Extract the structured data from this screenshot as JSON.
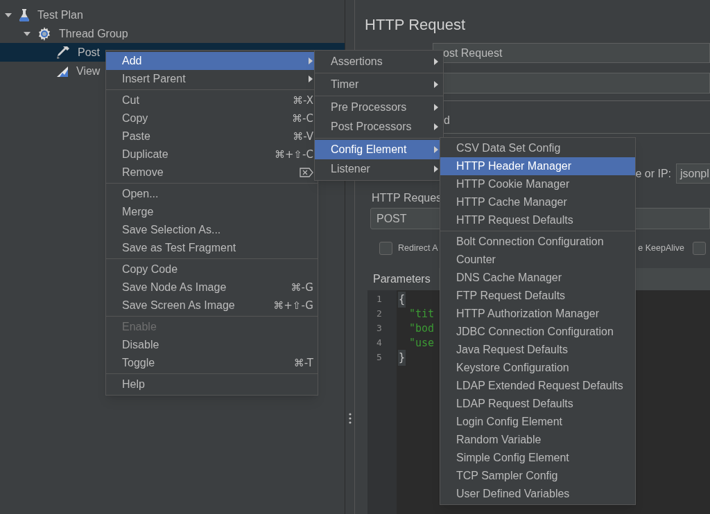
{
  "tree": [
    {
      "label": "Test Plan",
      "kind": "test_plan",
      "expanded": true,
      "selected": false,
      "children": [
        {
          "label": "Thread Group",
          "kind": "thread_group",
          "expanded": true,
          "selected": false,
          "children": [
            {
              "label": "Post",
              "kind": "sampler",
              "selected": false,
              "selected_row": true
            },
            {
              "label": "View",
              "kind": "listener",
              "selected": false,
              "selected_row": false
            }
          ]
        }
      ]
    }
  ],
  "form": {
    "title": "HTTP Request",
    "name_value": "ost Request",
    "tab_fragment": "d",
    "server_label": "e or IP:",
    "server_value": "jsonpl",
    "request_group_label": "HTTP Reques",
    "method": "POST",
    "checkboxes": [
      {
        "label": "Redirect A",
        "checked": false
      },
      {
        "label": "e KeepAlive",
        "checked": false
      }
    ],
    "tabs": [
      {
        "label": "Parameters",
        "selected": true
      }
    ],
    "code_lines": [
      {
        "number": "1",
        "text": "{",
        "kind": "brace"
      },
      {
        "number": "2",
        "text": "\"tit",
        "kind": "string"
      },
      {
        "number": "3",
        "text": "\"bod",
        "kind": "string"
      },
      {
        "number": "4",
        "text": "\"use",
        "kind": "string"
      },
      {
        "number": "5",
        "text": "}",
        "kind": "brace"
      }
    ]
  },
  "context_menu": {
    "groups": [
      [
        {
          "label": "Add",
          "kind": "submenu",
          "selected": true,
          "disabled": false
        },
        {
          "label": "Insert Parent",
          "kind": "submenu",
          "selected": false,
          "disabled": false
        }
      ],
      [
        {
          "label": "Cut",
          "kind": "item",
          "shortcut": "⌘-X",
          "selected": false,
          "disabled": false
        },
        {
          "label": "Copy",
          "kind": "item",
          "shortcut": "⌘-C",
          "selected": false,
          "disabled": false
        },
        {
          "label": "Paste",
          "kind": "item",
          "shortcut": "⌘-V",
          "selected": false,
          "disabled": false
        },
        {
          "label": "Duplicate",
          "kind": "item",
          "shortcut": "⌘+⇧-C",
          "selected": false,
          "disabled": false
        },
        {
          "label": "Remove",
          "kind": "delete_key",
          "selected": false,
          "disabled": false
        }
      ],
      [
        {
          "label": "Open...",
          "kind": "item",
          "selected": false,
          "disabled": false
        },
        {
          "label": "Merge",
          "kind": "item",
          "selected": false,
          "disabled": false
        },
        {
          "label": "Save Selection As...",
          "kind": "item",
          "selected": false,
          "disabled": false
        },
        {
          "label": "Save as Test Fragment",
          "kind": "item",
          "selected": false,
          "disabled": false
        }
      ],
      [
        {
          "label": "Copy Code",
          "kind": "item",
          "selected": false,
          "disabled": false
        },
        {
          "label": "Save Node As Image",
          "kind": "item",
          "shortcut": "⌘-G",
          "selected": false,
          "disabled": false
        },
        {
          "label": "Save Screen As Image",
          "kind": "item",
          "shortcut": "⌘+⇧-G",
          "selected": false,
          "disabled": false
        }
      ],
      [
        {
          "label": "Enable",
          "kind": "item",
          "selected": false,
          "disabled": true
        },
        {
          "label": "Disable",
          "kind": "item",
          "selected": false,
          "disabled": false
        },
        {
          "label": "Toggle",
          "kind": "item",
          "shortcut": "⌘-T",
          "selected": false,
          "disabled": false
        }
      ],
      [
        {
          "label": "Help",
          "kind": "item",
          "selected": false,
          "disabled": false
        }
      ]
    ]
  },
  "add_submenu": {
    "groups": [
      [
        {
          "label": "Assertions",
          "kind": "submenu",
          "selected": false
        }
      ],
      [
        {
          "label": "Timer",
          "kind": "submenu",
          "selected": false
        }
      ],
      [
        {
          "label": "Pre Processors",
          "kind": "submenu",
          "selected": false
        },
        {
          "label": "Post Processors",
          "kind": "submenu",
          "selected": false
        }
      ],
      [
        {
          "label": "Config Element",
          "kind": "submenu",
          "selected": true
        },
        {
          "label": "Listener",
          "kind": "submenu",
          "selected": false
        }
      ]
    ]
  },
  "config_element_submenu": {
    "groups": [
      [
        {
          "label": "CSV Data Set Config",
          "selected": false
        },
        {
          "label": "HTTP Header Manager",
          "selected": true
        },
        {
          "label": "HTTP Cookie Manager",
          "selected": false
        },
        {
          "label": "HTTP Cache Manager",
          "selected": false
        },
        {
          "label": "HTTP Request Defaults",
          "selected": false
        }
      ],
      [
        {
          "label": "Bolt Connection Configuration",
          "selected": false
        },
        {
          "label": "Counter",
          "selected": false
        },
        {
          "label": "DNS Cache Manager",
          "selected": false
        },
        {
          "label": "FTP Request Defaults",
          "selected": false
        },
        {
          "label": "HTTP Authorization Manager",
          "selected": false
        },
        {
          "label": "JDBC Connection Configuration",
          "selected": false
        },
        {
          "label": "Java Request Defaults",
          "selected": false
        },
        {
          "label": "Keystore Configuration",
          "selected": false
        },
        {
          "label": "LDAP Extended Request Defaults",
          "selected": false
        },
        {
          "label": "LDAP Request Defaults",
          "selected": false
        },
        {
          "label": "Login Config Element",
          "selected": false
        },
        {
          "label": "Random Variable",
          "selected": false
        },
        {
          "label": "Simple Config Element",
          "selected": false
        },
        {
          "label": "TCP Sampler Config",
          "selected": false
        },
        {
          "label": "User Defined Variables",
          "selected": false
        }
      ]
    ]
  }
}
